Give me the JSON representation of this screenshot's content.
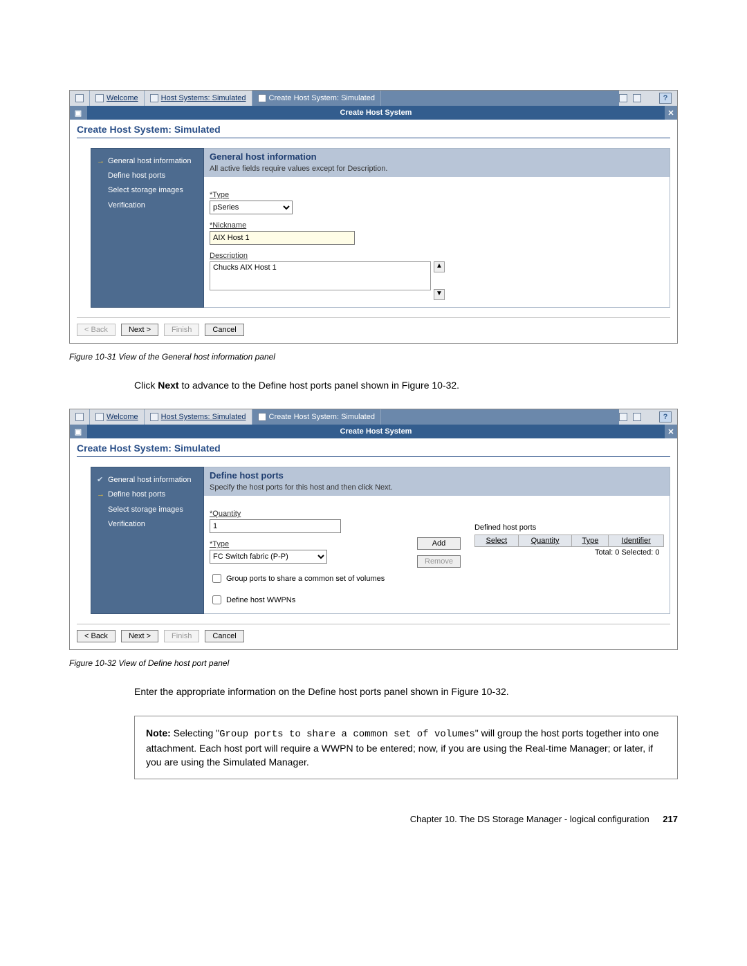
{
  "fig1": {
    "tabs": {
      "welcome": "Welcome",
      "hostSystems": "Host Systems: Simulated",
      "createHost": "Create Host System: Simulated"
    },
    "blueBarTitle": "Create Host System",
    "panelTitle": "Create Host System: Simulated",
    "steps": {
      "s1": "General host information",
      "s2": "Define host ports",
      "s3": "Select storage images",
      "s4": "Verification"
    },
    "sectionHead": "General host information",
    "sectionSub": "All active fields require values except for Description.",
    "form": {
      "typeLabel": "*Type",
      "typeValue": "pSeries",
      "nicknameLabel": "*Nickname",
      "nicknameValue": "AIX Host 1",
      "descLabel": "Description",
      "descValue": "Chucks AIX Host 1"
    },
    "buttons": {
      "back": "< Back",
      "next": "Next >",
      "finish": "Finish",
      "cancel": "Cancel"
    },
    "caption": "Figure 10-31   View of the General host information panel"
  },
  "midText": {
    "pre": "Click ",
    "bold": "Next",
    "post": " to advance to the Define host ports panel shown in Figure 10-32."
  },
  "fig2": {
    "tabs": {
      "welcome": "Welcome",
      "hostSystems": "Host Systems: Simulated",
      "createHost": "Create Host System: Simulated"
    },
    "blueBarTitle": "Create Host System",
    "panelTitle": "Create Host System: Simulated",
    "steps": {
      "s1": "General host information",
      "s2": "Define host ports",
      "s3": "Select storage images",
      "s4": "Verification"
    },
    "sectionHead": "Define host ports",
    "sectionSub": "Specify the host ports for this host and then click Next.",
    "form": {
      "quantityLabel": "*Quantity",
      "quantityValue": "1",
      "typeLabel": "*Type",
      "typeValue": "FC Switch fabric (P-P)",
      "groupPorts": "Group ports to share a common set of volumes",
      "defineWwpns": "Define host WWPNs",
      "addBtn": "Add",
      "removeBtn": "Remove",
      "definedHeader": "Defined host ports",
      "cols": {
        "select": "Select",
        "quantity": "Quantity",
        "type": "Type",
        "identifier": "Identifier"
      },
      "totals": "Total: 0   Selected: 0"
    },
    "buttons": {
      "back": "< Back",
      "next": "Next >",
      "finish": "Finish",
      "cancel": "Cancel"
    },
    "caption": "Figure 10-32   View of Define host port panel"
  },
  "afterText": "Enter the appropriate information on the Define host ports panel shown in Figure 10-32.",
  "note": {
    "lead": "Note: ",
    "t1": "Selecting \"",
    "mono": "Group ports to share a common set of volumes",
    "t2": "\" will group the host ports together into one attachment. Each host port will require a WWPN to be entered; now, if you are using the Real-time Manager; or later, if you are using the Simulated Manager."
  },
  "footer": {
    "chapter": "Chapter 10. The DS Storage Manager - logical configuration",
    "page": "217"
  }
}
